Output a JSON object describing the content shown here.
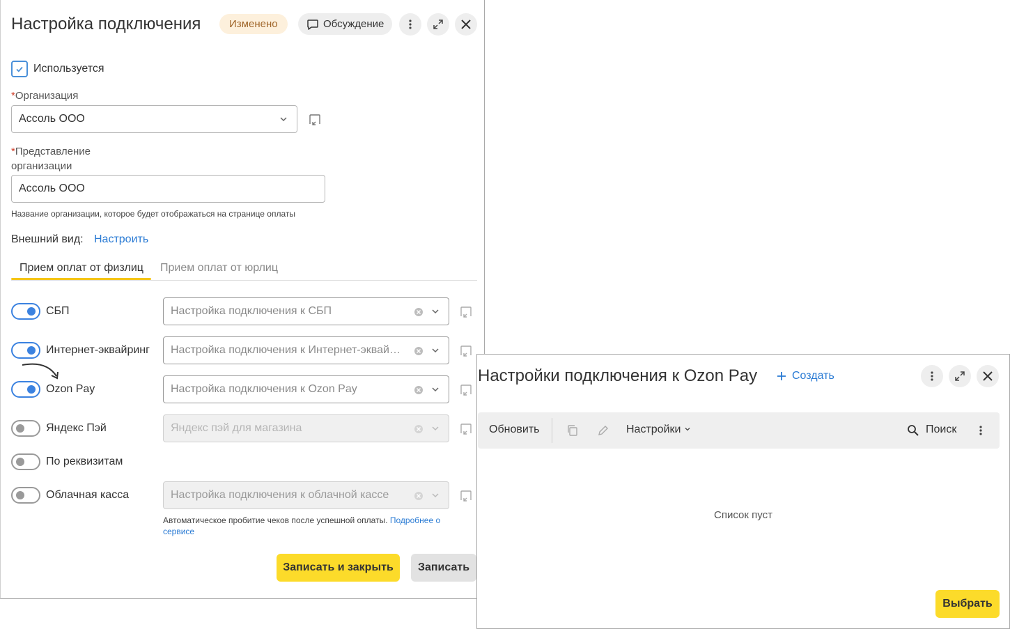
{
  "main_window": {
    "title": "Настройка подключения",
    "status_badge": "Изменено",
    "discussion_label": "Обсуждение",
    "used_checkbox": {
      "label": "Используется",
      "checked": true
    },
    "organization": {
      "label": "Организация",
      "value": "Ассоль ООО"
    },
    "org_representation": {
      "label_line1": "Представление",
      "label_line2": "организации",
      "value": "Ассоль ООО",
      "hint": "Название организации, которое будет отображаться на странице оплаты"
    },
    "appearance": {
      "label": "Внешний вид:",
      "link": "Настроить"
    },
    "tabs": [
      {
        "label": "Прием оплат от физлиц",
        "active": true
      },
      {
        "label": "Прием оплат от юрлиц",
        "active": false
      }
    ],
    "payment_methods": [
      {
        "label": "СБП",
        "enabled": true,
        "placeholder": "Настройка подключения к СБП"
      },
      {
        "label": "Интернет-эквайринг",
        "enabled": true,
        "placeholder": "Настройка подключения к Интернет-эквай…"
      },
      {
        "label": "Ozon Pay",
        "enabled": true,
        "placeholder": "Настройка подключения к Ozon Pay"
      },
      {
        "label": "Яндекс Пэй",
        "enabled": false,
        "placeholder": "Яндекс пэй для магазина"
      },
      {
        "label": "По реквизитам",
        "enabled": false,
        "placeholder": ""
      },
      {
        "label": "Облачная касса",
        "enabled": false,
        "placeholder": "Настройка подключения к облачной кассе"
      }
    ],
    "cloud_hint": {
      "text_line1": "Автоматическое пробитие чеков после успешной оплаты.",
      "link_line1": "Подробнее о",
      "link_line2": "сервисе"
    },
    "save_close_label": "Записать и закрыть",
    "save_label": "Записать"
  },
  "second_window": {
    "title": "Настройки подключения к Ozon Pay",
    "create_label": "Создать",
    "toolbar": {
      "refresh": "Обновить",
      "settings": "Настройки",
      "search": "Поиск"
    },
    "empty_text": "Список пуст",
    "select_label": "Выбрать"
  },
  "colors": {
    "accent_yellow": "#fcdb2a",
    "link_blue": "#2a7bd4",
    "toggle_blue": "#3b82e0",
    "badge_bg": "#fdf0dc"
  }
}
